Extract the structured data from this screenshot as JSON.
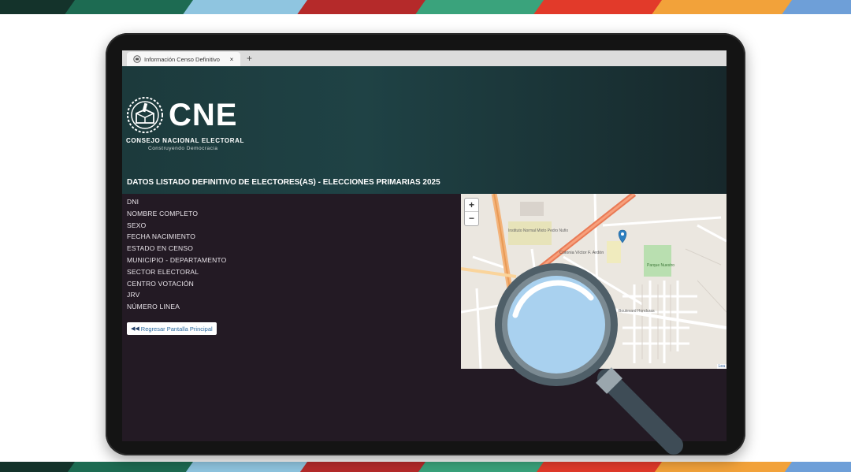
{
  "browser": {
    "tab_title": "Información Censo Definitivo",
    "close_glyph": "×",
    "new_tab_glyph": "+"
  },
  "header": {
    "logo_text": "CNE",
    "org_name": "CONSEJO NACIONAL ELECTORAL",
    "tagline": "Construyendo Democracia",
    "page_title": "DATOS LISTADO DEFINITIVO DE ELECTORES(AS) - ELECCIONES PRIMARIAS 2025"
  },
  "fields": [
    {
      "label": "DNI"
    },
    {
      "label": "NOMBRE COMPLETO"
    },
    {
      "label": "SEXO"
    },
    {
      "label": "FECHA NACIMIENTO"
    },
    {
      "label": "ESTADO EN CENSO"
    },
    {
      "label": "MUNICIPIO - DEPARTAMENTO"
    },
    {
      "label": "SECTOR ELECTORAL"
    },
    {
      "label": "CENTRO VOTACIÓN"
    },
    {
      "label": "JRV"
    },
    {
      "label": "NÚMERO LINEA"
    }
  ],
  "actions": {
    "back_label": "Regresar Pantalla Principal",
    "back_icon": "double-arrow-left-icon"
  },
  "map": {
    "zoom_in": "+",
    "zoom_out": "−",
    "attribution": "Lea",
    "labels": {
      "school": "Instituto Normal Mixto Pedro Nufio",
      "colonia": "Colonia Víctor F. Ardón",
      "park": "Parque Nuestro",
      "street": "Boulevard Honduras"
    }
  },
  "colors": {
    "header_bg": "#1f4245",
    "page_bg": "#231a24",
    "marker": "#2d7fc0",
    "stripe_colors": [
      "#1c6b54",
      "#8fc5e0",
      "#b52a2a",
      "#3aa37c",
      "#e23a2a",
      "#f2a23a",
      "#6e9fd8"
    ]
  }
}
